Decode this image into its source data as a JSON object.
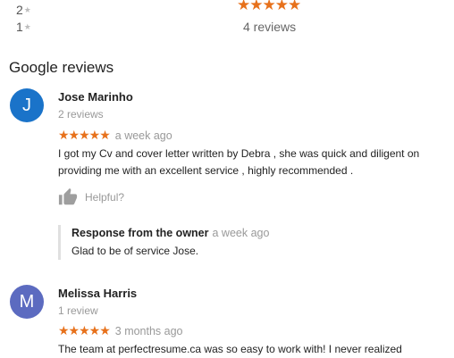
{
  "distribution": {
    "rows": [
      {
        "label": "2",
        "star": "★"
      },
      {
        "label": "1",
        "star": "★"
      }
    ]
  },
  "aggregate": {
    "stars": "★★★★★",
    "count_text": "4 reviews",
    "star_color": "#e7711b"
  },
  "section_title": "Google reviews",
  "reviews": [
    {
      "avatar_letter": "J",
      "avatar_color": "#1a73c9",
      "name": "Jose Marinho",
      "review_count": "2 reviews",
      "stars": "★★★★★",
      "time_ago": "a week ago",
      "text": "I got my Cv and cover letter written by Debra , she was quick and diligent on providing me with an excellent service , highly recommended .",
      "helpful_label": "Helpful?",
      "response": {
        "header": "Response from the owner",
        "time_ago": "a week ago",
        "text": "Glad to be of service Jose."
      }
    },
    {
      "avatar_letter": "M",
      "avatar_color": "#5c6bc0",
      "name": "Melissa Harris",
      "review_count": "1 review",
      "stars": "★★★★★",
      "time_ago": "3 months ago",
      "text": "The team at perfectresume.ca was so easy to work with! I never realized"
    }
  ]
}
